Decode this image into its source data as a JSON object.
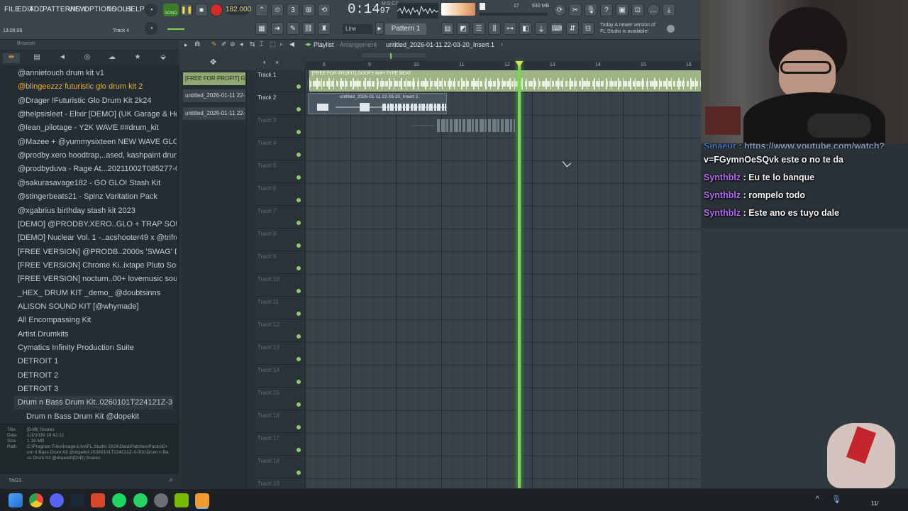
{
  "menu": {
    "items": [
      "FILE",
      "EDIT",
      "ADD",
      "PATTERNS",
      "VIEW",
      "OPTIONS",
      "TOOLS",
      "HELP"
    ]
  },
  "transport": {
    "mode_label": "SONG",
    "bpm": "182.000",
    "time": "0:14",
    "time_sub": "97",
    "time_unit": "M:S:CS",
    "cpu": "17",
    "memory": "630 MB"
  },
  "toolbar": {
    "snap_label": "Line",
    "pattern_label": "Pattern 1",
    "news_today": "Today",
    "news_text": "A newer version of FL Studio is available!",
    "hint_left": "13:06:06",
    "hint_right": "Track 4"
  },
  "browser": {
    "title": "Browser",
    "items": [
      {
        "label": "@annietouch drum kit v1",
        "style": "normal"
      },
      {
        "label": "@blingeezzz futuristic glo drum kit 2",
        "style": "hl"
      },
      {
        "label": "@Drager !Futuristic Glo Drum Kit 2k24",
        "style": "normal"
      },
      {
        "label": "@helpsisleet - Elixir [DEMO] (UK Garage & House)",
        "style": "normal"
      },
      {
        "label": "@lean_pilotage - Y2K WAVE ##drum_kit",
        "style": "normal"
      },
      {
        "label": "@Mazee + @yummysixteen NEW WAVE GLO kit",
        "style": "normal"
      },
      {
        "label": "@prodby.xero hoodtrap,..ased, kashpaint drum kit",
        "style": "normal"
      },
      {
        "label": "@prodbyduva - Rage At...20211002T085277-001",
        "style": "normal"
      },
      {
        "label": "@sakurasavage182 - GO GLO! Stash Kit",
        "style": "normal"
      },
      {
        "label": "@stingerbeats21 - Spinz Varitation Pack",
        "style": "normal"
      },
      {
        "label": "@xgabrius birthday stash kit 2023",
        "style": "normal"
      },
      {
        "label": "[DEMO] @PRODBY.XERO..GLO + TRAP SOUND KIT",
        "style": "normal"
      },
      {
        "label": "[DEMO] Nuclear Vol. 1 -..acshooter49 x @trifreeze",
        "style": "normal"
      },
      {
        "label": "[FREE VERSION] @PRODB..2000s 'SWAG' Drum Kit",
        "style": "normal"
      },
      {
        "label": "[FREE VERSION] Chrome Ki..ixtape Pluto Sound Kit",
        "style": "normal"
      },
      {
        "label": "[FREE VERSION] nocturn..00+ lovemusic sound kit",
        "style": "normal"
      },
      {
        "label": "_HEX_ DRUM KIT _demo_ @doubtsinns",
        "style": "normal"
      },
      {
        "label": "ALISON SOUND KIT [@whymade]",
        "style": "normal"
      },
      {
        "label": "All Encompassing Kit",
        "style": "normal"
      },
      {
        "label": "Artist Drumkits",
        "style": "normal"
      },
      {
        "label": "Cymatics Infinity Production Suite",
        "style": "normal"
      },
      {
        "label": "DETROIT 1",
        "style": "normal"
      },
      {
        "label": "DETROIT 2",
        "style": "normal"
      },
      {
        "label": "DETROIT 3",
        "style": "normal"
      },
      {
        "label": "Drum n Bass Drum Kit..0260101T224121Z-3-001",
        "style": "sel"
      },
      {
        "label": "Drum n Bass Drum Kit @dopekit",
        "style": "sub"
      }
    ],
    "info": {
      "title_k": "Title",
      "title_v": "[DnB] Snares",
      "date_k": "Date",
      "date_v": "1/1/2026 19:42:12",
      "size_k": "Size",
      "size_v": "1.16 MB",
      "path_k": "Path",
      "path_v": "C:\\Program Files\\Image-Line\\FL Studio 2024\\Data\\Patches\\Packs\\Drum n Bass Drum Kit @dopekit-20260101T224121Z-3-001\\Drum n Bass Drum Kit @dopekit\\[DnB] Snares"
    },
    "tags_label": "TAGS"
  },
  "playlist": {
    "title": "Playlist",
    "view": "Arrangement",
    "arrangement": "untitled_2026-01-11 22-03-20_Insert 1",
    "clip_buttons": [
      "[FREE FOR PROFIT] G...",
      "untitled_2026-01-11 22-...",
      "untitled_2026-01-11 22-..."
    ],
    "ruler": [
      "8",
      "9",
      "10",
      "11",
      "12",
      "13",
      "14",
      "15",
      "16"
    ],
    "tracks": [
      "Track 1",
      "Track 2",
      "Track 3",
      "Track 4",
      "Track 5",
      "Track 6",
      "Track 7",
      "Track 8",
      "Track 9",
      "Track 10",
      "Track 11",
      "Track 12",
      "Track 13",
      "Track 14",
      "Track 15",
      "Track 16",
      "Track 17",
      "Track 18",
      "Track 19"
    ],
    "clip1_label": "[FREE FOR PROFIT] GOOFY AHH TYPE BEAT",
    "clip2_label": "untitled_2026-01-11 22-03-20_Insert 1"
  },
  "chat": {
    "partial_user": "Sinaeur",
    "partial_msg": "https://www.youtube.com/watch?",
    "lines": [
      {
        "user": "",
        "msg": "v=FGymnOeSQvk este o no te da"
      },
      {
        "user": "Synthblz",
        "msg": "Eu te lo banque"
      },
      {
        "user": "Synthblz",
        "msg": "rompelo todo"
      },
      {
        "user": "Synthblz",
        "msg": "Este ano es tuyo dale"
      }
    ]
  },
  "taskbar": {
    "clock": "11/",
    "apps": [
      "windows-start",
      "chrome",
      "discord",
      "steam",
      "fl-studio-taskbar",
      "spotify",
      "whatsapp",
      "settings",
      "nvidia",
      "fl-studio-active"
    ]
  },
  "colors": {
    "accent": "#7cd655",
    "audio_clip": "#9fb585",
    "chat_user": "#b66cf2",
    "browser_highlight": "#e0b14a"
  }
}
